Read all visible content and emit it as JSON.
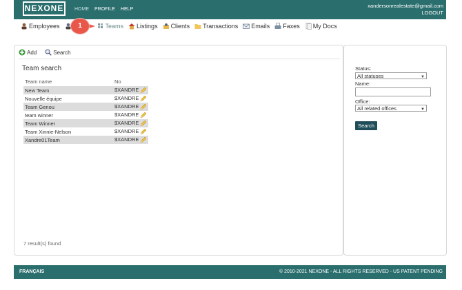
{
  "header": {
    "logo": "NEXONE",
    "nav": [
      "HOME",
      "PROFILE",
      "HELP"
    ],
    "account_email": "xandersonrealestate@gmail.com",
    "logout": "LOGOUT"
  },
  "modules": [
    {
      "label": "Employees",
      "icon": "person-icon"
    },
    {
      "label": "Teams",
      "icon": "team-icon"
    },
    {
      "label": "Listings",
      "icon": "house-icon"
    },
    {
      "label": "Clients",
      "icon": "client-icon"
    },
    {
      "label": "Transactions",
      "icon": "folder-icon"
    },
    {
      "label": "Emails",
      "icon": "email-icon"
    },
    {
      "label": "Faxes",
      "icon": "fax-icon"
    },
    {
      "label": "My Docs",
      "icon": "docs-icon"
    }
  ],
  "step_badge": "1",
  "toolbar": {
    "add": "Add",
    "search": "Search"
  },
  "main": {
    "title": "Team search",
    "columns": [
      "Team name",
      "No"
    ],
    "rows": [
      {
        "name": "New Team",
        "no": "$XANDRE"
      },
      {
        "name": "Nouvelle équipe",
        "no": "$XANDRE"
      },
      {
        "name": "Team Genou",
        "no": "$XANDRE"
      },
      {
        "name": "team winner",
        "no": "$XANDRE"
      },
      {
        "name": "Team Winner",
        "no": "$XANDRE"
      },
      {
        "name": "Team Xinnie-Nelson",
        "no": "$XANDRE"
      },
      {
        "name": "Xandre01Team",
        "no": "$XANDRE"
      }
    ],
    "count_text": "7 result(s) found"
  },
  "filters": {
    "status_label": "Status:",
    "status_value": "All statuses",
    "name_label": "Name:",
    "name_value": "",
    "office_label": "Office:",
    "office_value": "All related offices",
    "search_button": "Search"
  },
  "footer": {
    "language": "FRANÇAIS",
    "copyright": "© 2010-2021 NEXONE - ALL RIGHTS RESERVED - US PATENT PENDING"
  }
}
